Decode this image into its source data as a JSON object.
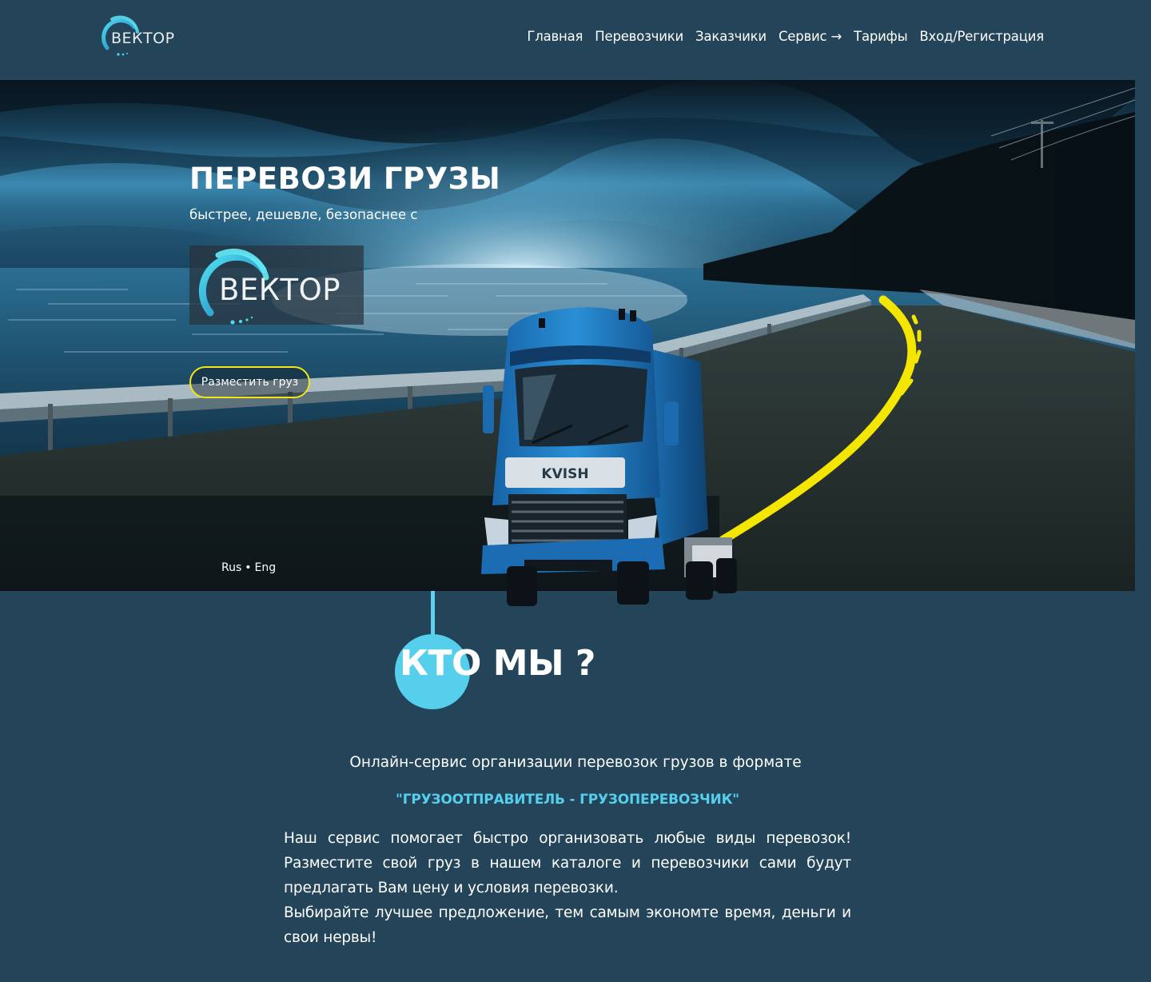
{
  "header": {
    "logo_text": "ВЕКТОР",
    "nav": [
      {
        "label": "Главная"
      },
      {
        "label": "Перевозчики"
      },
      {
        "label": "Заказчики"
      },
      {
        "label": "Сервис →"
      },
      {
        "label": "Тарифы"
      },
      {
        "label": "Вход/Регистрация"
      }
    ]
  },
  "hero": {
    "title": "ПЕРЕВОЗИ ГРУЗЫ",
    "subtitle": "быстрее, дешевле, безопаснее с",
    "logo_text": "ВЕКТОР",
    "cta_label": "Разместить груз",
    "lang": {
      "rus": "Rus",
      "separator": "•",
      "eng": "Eng"
    },
    "truck_brand": "KVISH"
  },
  "about": {
    "title": "КТО МЫ ?",
    "intro": "Онлайн-сервис организации перевозок грузов в формате",
    "highlight": "\"ГРУЗООТПРАВИТЕЛЬ - ГРУЗОПЕРЕВОЗЧИК\"",
    "paragraph_1": "Наш сервис помогает быстро организовать любые виды перевозок! Разместите свой груз в нашем каталоге и перевозчики сами будут предлагать Вам цену и условия перевозки.",
    "paragraph_2": "Выбирайте лучшее предложение, тем самым экономте время, деньги и свои нервы!"
  },
  "colors": {
    "background": "#234459",
    "accent_cyan": "#55cfec",
    "cta_border": "#f2e619",
    "road_line": "#f5e600",
    "truck_blue": "#1f7fc4"
  }
}
